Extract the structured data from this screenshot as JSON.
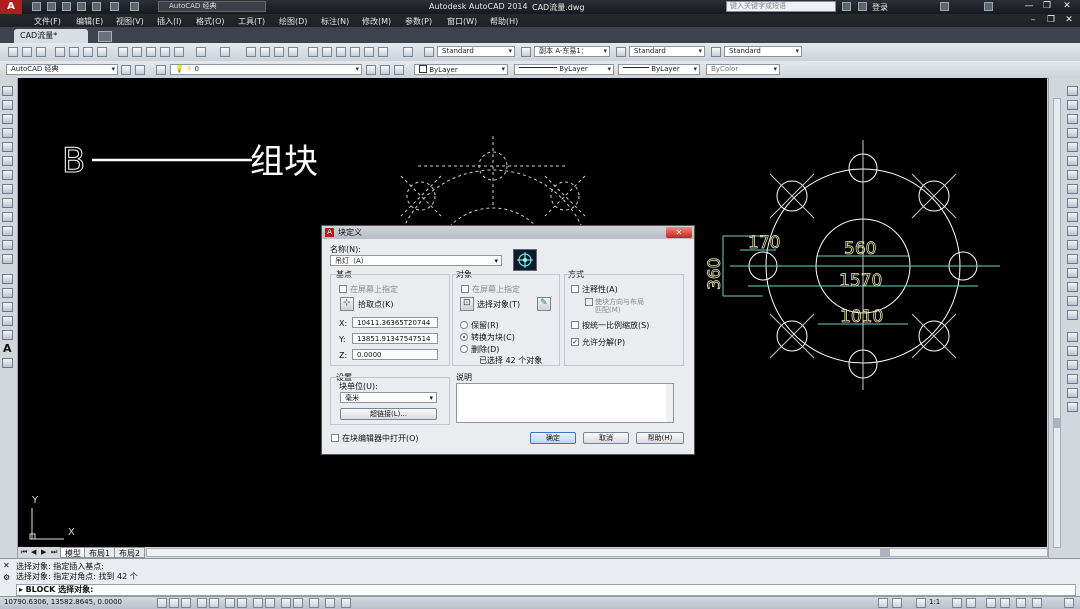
{
  "titlebar": {
    "workspace": "AutoCAD 经典",
    "app_title": "Autodesk AutoCAD 2014",
    "file_title": "CAD流量.dwg",
    "search_placeholder": "键入关键字或短语",
    "login": "登录",
    "minimize": "—",
    "restore": "❐",
    "close": "✕"
  },
  "menus": [
    "文件(F)",
    "编辑(E)",
    "视图(V)",
    "插入(I)",
    "格式(O)",
    "工具(T)",
    "绘图(D)",
    "标注(N)",
    "修改(M)",
    "参数(P)",
    "窗口(W)",
    "帮助(H)"
  ],
  "tabs": {
    "doc": "CAD流量*"
  },
  "toolbar": {
    "text_style": "Standard",
    "dim_style": "副本 A-东易1：",
    "table_style": "Standard",
    "mleader_style": "Standard",
    "workspace2": "AutoCAD 经典",
    "layer": "0",
    "color": "ByLayer",
    "linetype": "ByLayer",
    "lineweight": "ByLayer",
    "plotstyle": "ByColor"
  },
  "canvas": {
    "annotation_b": "B",
    "annotation_text": "组块",
    "dims": {
      "d560": "560",
      "d1570": "1570",
      "d1010": "1010",
      "d170": "170",
      "d360": "360"
    },
    "ucs_y": "Y",
    "ucs_x": "X"
  },
  "dialog": {
    "title": "块定义",
    "close": "✕",
    "name_label": "名称(N):",
    "name_value": "吊灯（A）",
    "base_point": {
      "header": "基点",
      "specify_on_screen": "在屏幕上指定",
      "pick_button": "拾取点(K)",
      "x_label": "X:",
      "x_value": "10411.36365T20744",
      "y_label": "Y:",
      "y_value": "13851.91347547514",
      "z_label": "Z:",
      "z_value": "0.0000"
    },
    "objects": {
      "header": "对象",
      "specify_on_screen": "在屏幕上指定",
      "select_button": "选择对象(T)",
      "retain": "保留(R)",
      "convert": "转换为块(C)",
      "delete": "删除(D)",
      "selected_count": "已选择 42 个对象"
    },
    "behavior": {
      "header": "方式",
      "annotative": "注释性(A)",
      "match_orient": "使块方向与布局",
      "match_orient2": "匹配(M)",
      "uniform_scale": "按统一比例缩放(S)",
      "allow_explode": "允许分解(P)"
    },
    "settings": {
      "header": "设置",
      "units_label": "块单位(U):",
      "units_value": "毫米",
      "hyperlink": "超链接(L)..."
    },
    "description": {
      "header": "说明"
    },
    "open_in_editor": "在块编辑器中打开(O)",
    "ok": "确定",
    "cancel": "取消",
    "help": "帮助(H)"
  },
  "layout_tabs": [
    "模型",
    "布局1",
    "布局2"
  ],
  "command": {
    "line1": "选择对象:   指定插入基点:",
    "line2": "选择对象:  指定对角点: 找到 42 个",
    "prompt": "BLOCK 选择对象:"
  },
  "status": {
    "coords": "10790.6306,  13582.8645,  0.0000",
    "scale": "1:1"
  }
}
